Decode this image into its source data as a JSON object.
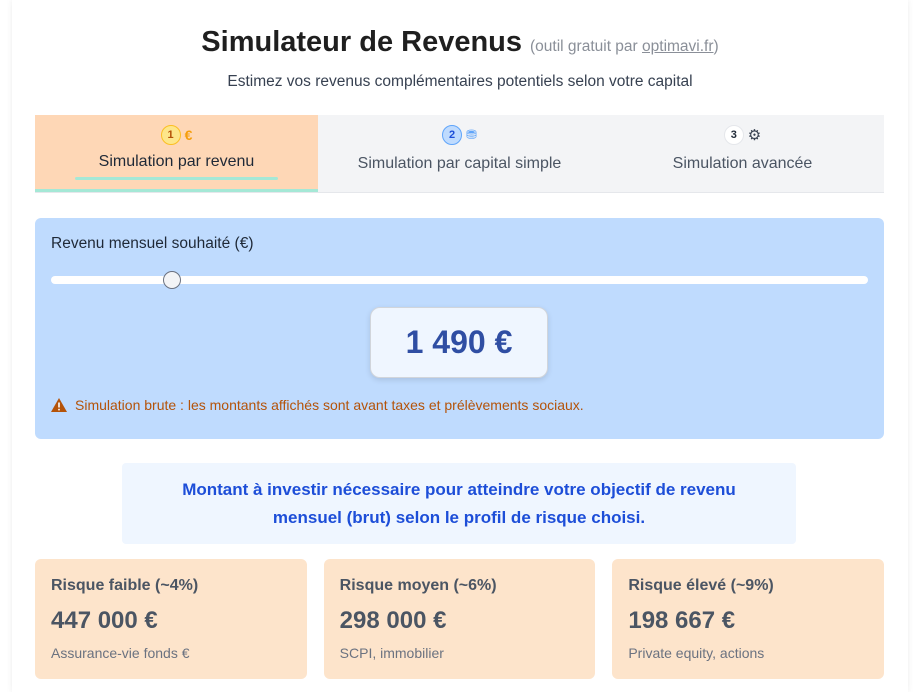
{
  "header": {
    "title": "Simulateur de Revenus",
    "note_prefix": "(outil gratuit par ",
    "note_link": "optimavi.fr",
    "note_suffix": ")",
    "tagline": "Estimez vos revenus complémentaires potentiels selon votre capital"
  },
  "tabs": [
    {
      "step": "1",
      "icon": "euro-icon",
      "icon_glyph": "€",
      "label": "Simulation par revenu",
      "active": true
    },
    {
      "step": "2",
      "icon": "coins-icon",
      "icon_glyph": "⛃",
      "label": "Simulation par capital simple",
      "active": false
    },
    {
      "step": "3",
      "icon": "gears-icon",
      "icon_glyph": "⚙",
      "label": "Simulation avancée",
      "active": false
    }
  ],
  "slider": {
    "label": "Revenu mensuel souhaité (€)",
    "position_fraction": 0.148,
    "value_display": "1 490 €",
    "warning": "Simulation brute : les montants affichés sont avant taxes et prélèvements sociaux."
  },
  "info": {
    "text": "Montant à investir nécessaire pour atteindre votre objectif de revenu mensuel (brut) selon le profil de risque choisi."
  },
  "cards": [
    {
      "title": "Risque faible (~4%)",
      "amount": "447 000 €",
      "desc": "Assurance-vie fonds €"
    },
    {
      "title": "Risque moyen (~6%)",
      "amount": "298 000 €",
      "desc": "SCPI, immobilier"
    },
    {
      "title": "Risque élevé (~9%)",
      "amount": "198 667 €",
      "desc": "Private equity, actions"
    }
  ],
  "colors": {
    "accent_blue": "#1d4ed8",
    "warning_orange": "#b45309",
    "active_tab": "#fed7b6",
    "panel_blue": "#bfdbfe",
    "card_bg": "#fde4cb"
  }
}
